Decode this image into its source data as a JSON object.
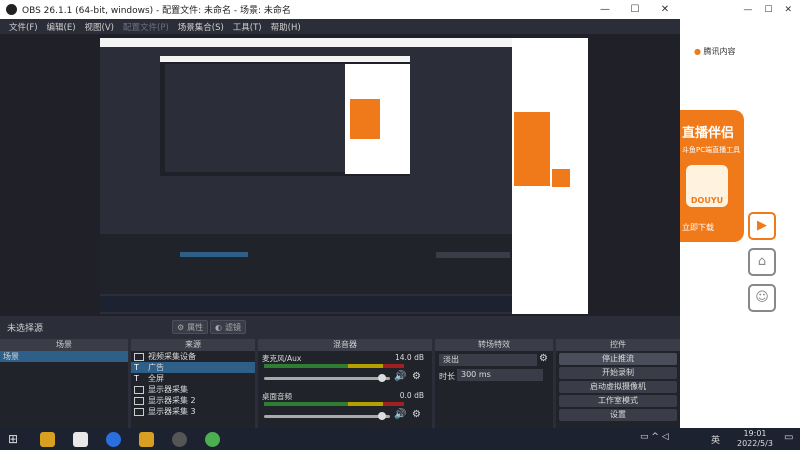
{
  "window": {
    "title": "OBS 26.1.1 (64-bit, windows) - 配置文件: 未命名 - 场景: 未命名"
  },
  "menu": [
    "文件(F)",
    "编辑(E)",
    "视图(V)",
    "配置文件(P)",
    "场景集合(S)",
    "工具(T)",
    "帮助(H)"
  ],
  "status": {
    "no_source": "未选择源",
    "props": "属性",
    "filters": "滤镜"
  },
  "docks": {
    "scenes": "场景",
    "sources": "来源",
    "mixer": "混音器",
    "transitions": "转场特效",
    "controls": "控件"
  },
  "scenes": [
    "场景"
  ],
  "sources": [
    "视频采集设备",
    "广告",
    "全屏",
    "显示器采集",
    "显示器采集 2",
    "显示器采集 3"
  ],
  "mixer": [
    {
      "name": "麦克风/Aux",
      "level": "14.0 dB"
    },
    {
      "name": "桌面音频",
      "level": "0.0 dB"
    }
  ],
  "transitions": {
    "selected": "淡出",
    "duration_label": "时长",
    "duration": "300 ms"
  },
  "controls": [
    "停止推流",
    "开始录制",
    "启动虚拟摄像机",
    "工作室模式",
    "设置"
  ],
  "taskbar": {
    "time": "19:01",
    "date": "2022/5/3",
    "lang": "英"
  },
  "right": {
    "brand": "直播伴侣",
    "sub": "斗鱼PC端直播工具",
    "btn": "立即下载",
    "logo": "DOUYU",
    "tab": "腾讯内容",
    "hint": "主"
  },
  "colors": {
    "obs_bg": "#2b2e38",
    "select": "#2e5f89",
    "accent": "#f07a1a"
  }
}
